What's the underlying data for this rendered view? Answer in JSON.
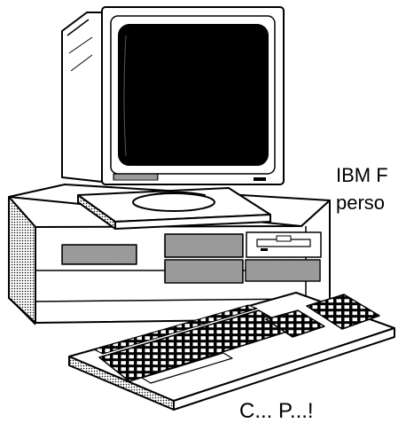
{
  "caption": {
    "line1": "IBM F",
    "line2": "perso",
    "line3": "C... P...!"
  },
  "illustration": {
    "subject": "desktop-personal-computer",
    "parts": [
      "crt-monitor",
      "swivel-stand",
      "system-unit",
      "floppy-drive",
      "drive-bays",
      "keyboard"
    ],
    "style": "black-and-white line art with stippled shading"
  },
  "colors": {
    "ink": "#000000",
    "paper": "#ffffff",
    "screen": "#000000",
    "stipple": "#9a9a9a"
  }
}
